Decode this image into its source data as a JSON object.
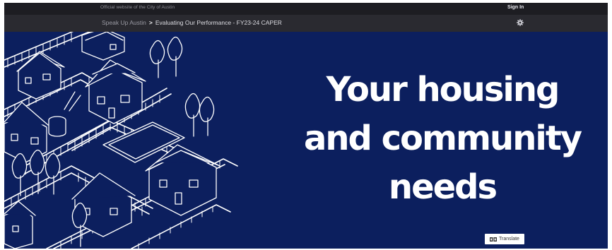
{
  "topbar": {
    "official_text": "Official website of the City of Austin",
    "signin_label": "Sign In"
  },
  "breadcrumb": {
    "home": "Speak Up Austin",
    "separator": ">",
    "current": "Evaluating Our Performance - FY23-24 CAPER"
  },
  "settings_icon": "gear-icon",
  "hero": {
    "headline_lines": [
      "Your housing",
      "and community",
      "needs"
    ],
    "background_color": "#0c1f5e"
  },
  "translate": {
    "label": "Translate",
    "icon": "translate-icon"
  }
}
